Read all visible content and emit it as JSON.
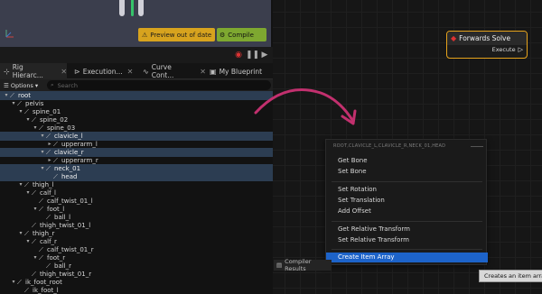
{
  "viewport": {
    "preview_label": "Preview out of date",
    "compile_label": "Compile"
  },
  "tabs": [
    {
      "label": "Rig Hierarc..."
    },
    {
      "label": "Execution..."
    },
    {
      "label": "Curve Cont..."
    },
    {
      "label": "My Blueprint"
    }
  ],
  "toolbar": {
    "options_label": "Options",
    "search_placeholder": "Search"
  },
  "tree": [
    {
      "label": "root",
      "depth": 0,
      "sel": true,
      "arrow": "▾"
    },
    {
      "label": "pelvis",
      "depth": 1,
      "sel": false,
      "arrow": "▾"
    },
    {
      "label": "spine_01",
      "depth": 2,
      "sel": false,
      "arrow": "▾"
    },
    {
      "label": "spine_02",
      "depth": 3,
      "sel": false,
      "arrow": "▾"
    },
    {
      "label": "spine_03",
      "depth": 4,
      "sel": false,
      "arrow": "▾"
    },
    {
      "label": "clavicle_l",
      "depth": 5,
      "sel": true,
      "arrow": "▾"
    },
    {
      "label": "upperarm_l",
      "depth": 6,
      "sel": false,
      "arrow": "▸"
    },
    {
      "label": "clavicle_r",
      "depth": 5,
      "sel": true,
      "arrow": "▾"
    },
    {
      "label": "upperarm_r",
      "depth": 6,
      "sel": false,
      "arrow": "▸"
    },
    {
      "label": "neck_01",
      "depth": 5,
      "sel": true,
      "arrow": "▾"
    },
    {
      "label": "head",
      "depth": 6,
      "sel": true,
      "arrow": ""
    },
    {
      "label": "thigh_l",
      "depth": 2,
      "sel": false,
      "arrow": "▾"
    },
    {
      "label": "calf_l",
      "depth": 3,
      "sel": false,
      "arrow": "▾"
    },
    {
      "label": "calf_twist_01_l",
      "depth": 4,
      "sel": false,
      "arrow": ""
    },
    {
      "label": "foot_l",
      "depth": 4,
      "sel": false,
      "arrow": "▾"
    },
    {
      "label": "ball_l",
      "depth": 5,
      "sel": false,
      "arrow": ""
    },
    {
      "label": "thigh_twist_01_l",
      "depth": 3,
      "sel": false,
      "arrow": ""
    },
    {
      "label": "thigh_r",
      "depth": 2,
      "sel": false,
      "arrow": "▾"
    },
    {
      "label": "calf_r",
      "depth": 3,
      "sel": false,
      "arrow": "▾"
    },
    {
      "label": "calf_twist_01_r",
      "depth": 4,
      "sel": false,
      "arrow": ""
    },
    {
      "label": "foot_r",
      "depth": 4,
      "sel": false,
      "arrow": "▾"
    },
    {
      "label": "ball_r",
      "depth": 5,
      "sel": false,
      "arrow": ""
    },
    {
      "label": "thigh_twist_01_r",
      "depth": 3,
      "sel": false,
      "arrow": ""
    },
    {
      "label": "ik_foot_root",
      "depth": 1,
      "sel": false,
      "arrow": "▾"
    },
    {
      "label": "ik_foot_l",
      "depth": 2,
      "sel": false,
      "arrow": ""
    }
  ],
  "node": {
    "title": "Forwards Solve",
    "pin_label": "Execute"
  },
  "context_menu": {
    "header": "ROOT,CLAVICLE_L,CLAVICLE_R,NECK_01,HEAD",
    "items": [
      {
        "label": "Get Bone"
      },
      {
        "label": "Set Bone"
      },
      {
        "label": "Set Rotation"
      },
      {
        "label": "Set Translation"
      },
      {
        "label": "Add Offset"
      },
      {
        "label": "Get Relative Transform"
      },
      {
        "label": "Set Relative Transform"
      },
      {
        "label": "Create Item Array"
      }
    ]
  },
  "compiler_tab_label": "Compiler Results",
  "tooltip_text": "Creates an item array",
  "colors": {
    "accent_orange": "#e6a31c",
    "compile_green": "#7ea830",
    "selection_blue": "#1d63c9",
    "arrow_magenta": "#c2306e"
  }
}
